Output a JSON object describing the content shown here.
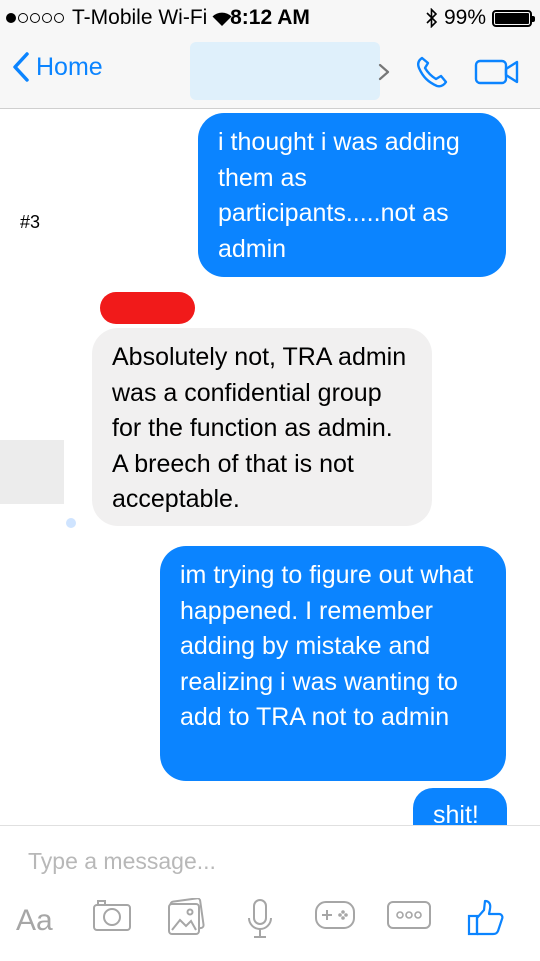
{
  "status_bar": {
    "carrier": "T-Mobile Wi-Fi",
    "time": "8:12 AM",
    "battery": "99%",
    "battery_level": 0.99
  },
  "nav": {
    "back_label": "Home"
  },
  "conversation": {
    "tag": "#3",
    "messages": [
      {
        "direction": "outgoing",
        "text": "i thought i was adding them as participants.....not as admin"
      },
      {
        "direction": "incoming",
        "text": "Absolutely not, TRA admin was a confidential group for the function as admin. A breech of that is not acceptable."
      },
      {
        "direction": "outgoing",
        "text": "im trying to figure out what happened. I remember adding by mistake and realizing i was wanting to add to TRA not to admin"
      },
      {
        "direction": "outgoing",
        "text": "shit!"
      }
    ]
  },
  "composer": {
    "placeholder": "Type a message...",
    "text_button": "Aa"
  },
  "colors": {
    "accent": "#0b84ff",
    "incoming_bubble": "#f1f0f0",
    "redaction": "#f11a1a"
  },
  "icons": [
    "back-chevron-icon",
    "bluetooth-icon",
    "wifi-icon",
    "phone-icon",
    "video-camera-icon",
    "camera-icon",
    "gallery-icon",
    "microphone-icon",
    "game-controller-icon",
    "more-icon",
    "thumbs-up-icon"
  ]
}
